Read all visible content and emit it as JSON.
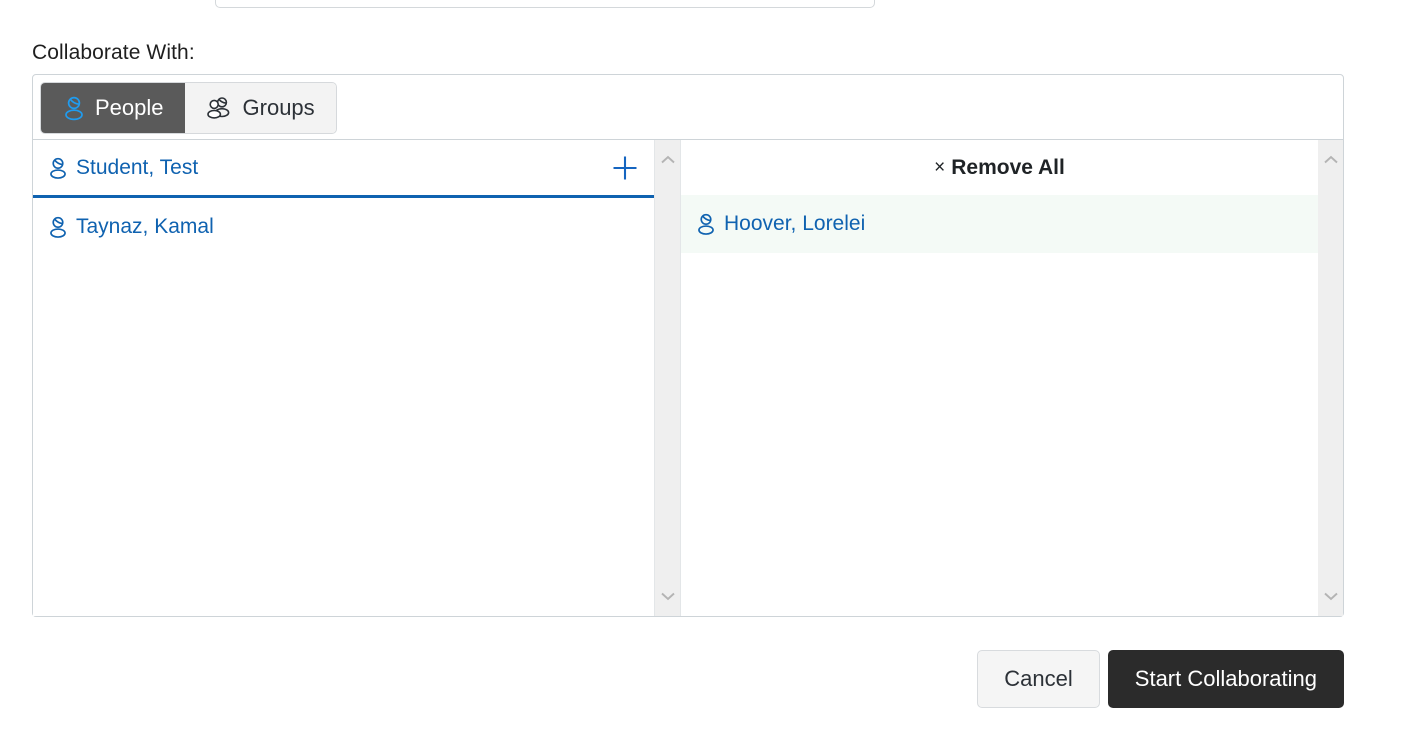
{
  "top_cut_field": {
    "value": ""
  },
  "section": {
    "label": "Collaborate With:"
  },
  "tabs": [
    {
      "label": "People",
      "icon": "person-icon",
      "active": true
    },
    {
      "label": "Groups",
      "icon": "people-group-icon",
      "active": false
    }
  ],
  "available_list": {
    "add_icon": "plus-icon",
    "items": [
      {
        "label": "Student, Test",
        "icon": "person-icon",
        "focused": true
      },
      {
        "label": "Taynaz, Kamal",
        "icon": "person-icon",
        "focused": false
      }
    ]
  },
  "selected_list": {
    "remove_all_label": "Remove All",
    "remove_all_glyph": "×",
    "items": [
      {
        "label": "Hoover, Lorelei",
        "icon": "person-icon",
        "selected": true
      }
    ]
  },
  "scrollbars": {
    "up_glyph": "chevron-up-icon",
    "down_glyph": "chevron-down-icon"
  },
  "footer": {
    "cancel_label": "Cancel",
    "submit_label": "Start Collaborating"
  },
  "colors": {
    "link_blue": "#0f62b0",
    "accent_blue": "#1f9cf0",
    "active_tab_bg": "#5a5a5a",
    "primary_btn_bg": "#2b2b2b",
    "selected_row_bg": "#f4faf6"
  }
}
